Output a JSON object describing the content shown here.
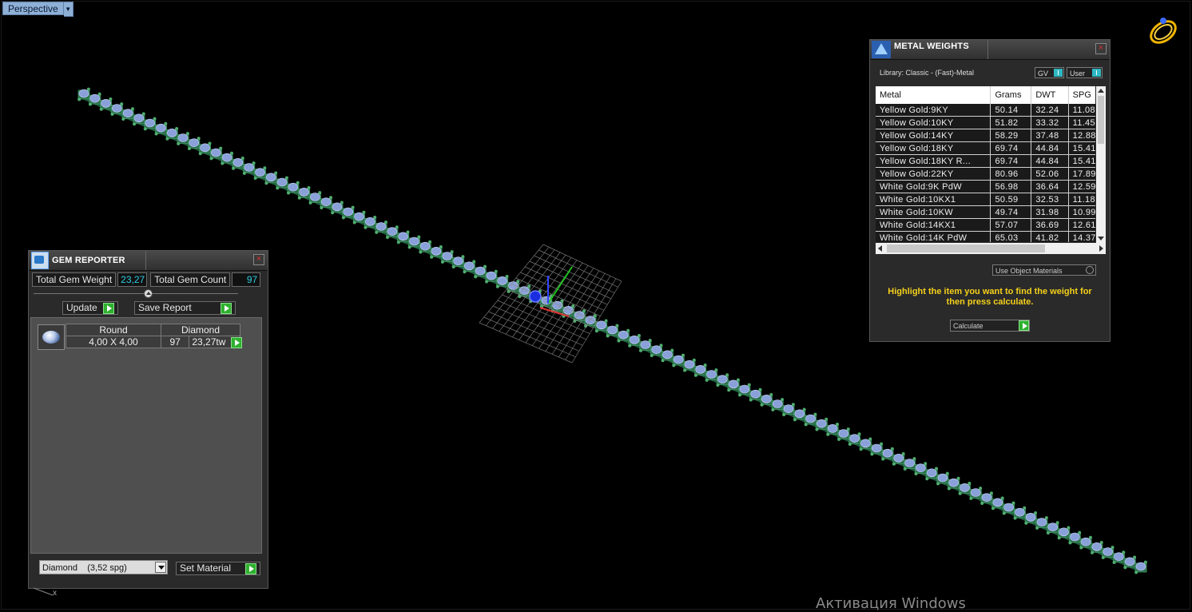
{
  "viewport": {
    "label": "Perspective"
  },
  "gem_reporter": {
    "title": "GEM REPORTER",
    "total_gem_weight_label": "Total Gem Weight",
    "total_gem_weight": "23,27",
    "total_gem_count_label": "Total Gem Count",
    "total_gem_count": "97",
    "update_label": "Update",
    "save_report_label": "Save Report",
    "gem": {
      "shape": "Round",
      "material": "Diamond",
      "size": "4,00 X 4,00",
      "count": "97",
      "weight": "23,27tw"
    },
    "material_select": "Diamond    (3,52 spg)",
    "set_material_label": "Set Material"
  },
  "metal_weights": {
    "title": "METAL WEIGHTS",
    "library": "Library: Classic - (Fast)-Metal",
    "gv_label": "GV",
    "user_label": "User",
    "columns": [
      "Metal",
      "Grams",
      "DWT",
      "SPG"
    ],
    "rows": [
      [
        "Yellow Gold:9KY",
        "50.14",
        "32.24",
        "11.08"
      ],
      [
        "Yellow Gold:10KY",
        "51.82",
        "33.32",
        "11.45"
      ],
      [
        "Yellow Gold:14KY",
        "58.29",
        "37.48",
        "12.88"
      ],
      [
        "Yellow Gold:18KY",
        "69.74",
        "44.84",
        "15.41"
      ],
      [
        "Yellow Gold:18KY R...",
        "69.74",
        "44.84",
        "15.41"
      ],
      [
        "Yellow Gold:22KY",
        "80.96",
        "52.06",
        "17.89"
      ],
      [
        "White Gold:9K PdW",
        "56.98",
        "36.64",
        "12.59"
      ],
      [
        "White Gold:10KX1",
        "50.59",
        "32.53",
        "11.18"
      ],
      [
        "White Gold:10KW",
        "49.74",
        "31.98",
        "10.99"
      ],
      [
        "White Gold:14KX1",
        "57.07",
        "36.69",
        "12.61"
      ],
      [
        "White Gold:14K PdW",
        "65.03",
        "41.82",
        "14.37"
      ]
    ],
    "use_object_materials": "Use Object Materials",
    "hint": "Highlight the item you want to find the weight for then press calculate.",
    "calculate_label": "Calculate"
  },
  "watermark": "Активация Windows",
  "axis_label": "x",
  "colors": {
    "gem_value": "#2ecbe0",
    "hint": "#f5d01a",
    "accent_green": "#2fb12f",
    "tab": "#8eb0d6"
  }
}
